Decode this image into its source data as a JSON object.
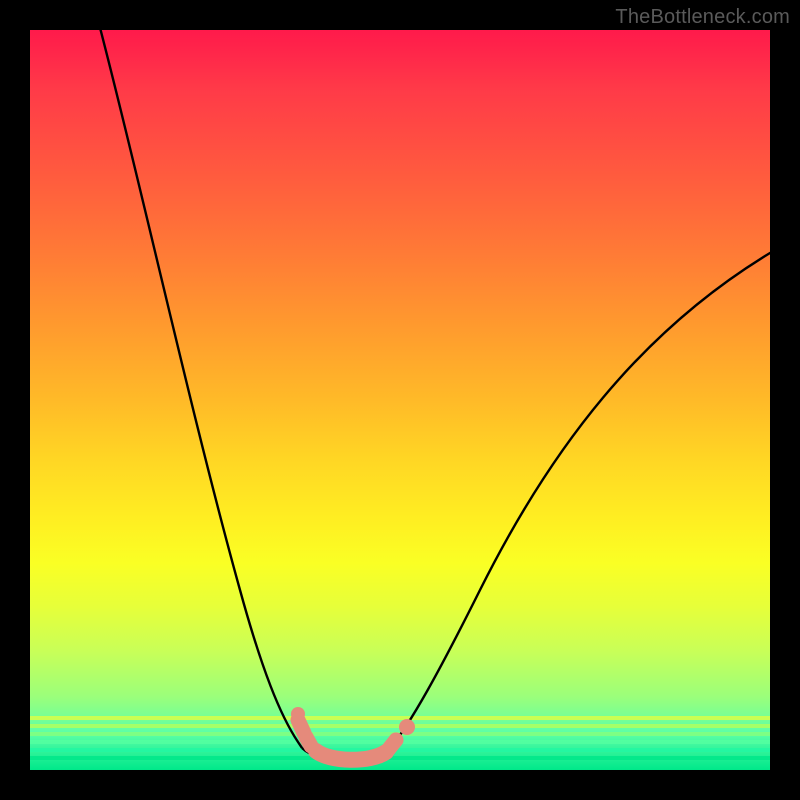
{
  "watermark": "TheBottleneck.com",
  "chart_data": {
    "type": "line",
    "title": "",
    "xlabel": "",
    "ylabel": "",
    "xlim": [
      0,
      100
    ],
    "ylim": [
      0,
      100
    ],
    "background": {
      "type": "vertical-gradient",
      "stops": [
        {
          "pos": 0,
          "color": "#ff1a4b"
        },
        {
          "pos": 50,
          "color": "#ffba28"
        },
        {
          "pos": 72,
          "color": "#faff24"
        },
        {
          "pos": 100,
          "color": "#00e88a"
        }
      ],
      "meaning": "red=high bottleneck, green=low bottleneck"
    },
    "series": [
      {
        "name": "bottleneck-curve",
        "color": "#000000",
        "x": [
          9,
          15,
          22,
          28,
          32,
          36,
          38,
          40,
          44,
          48,
          52,
          58,
          68,
          82,
          100
        ],
        "y": [
          100,
          80,
          55,
          32,
          15,
          5,
          2,
          1,
          2,
          5,
          15,
          30,
          50,
          64,
          72
        ]
      }
    ],
    "highlight_points": {
      "color": "#e58a7b",
      "x": [
        36,
        37,
        38,
        40,
        44,
        48,
        49,
        51
      ],
      "y": [
        7,
        5,
        3,
        1,
        1,
        3,
        4,
        6
      ]
    },
    "grid": false,
    "legend": false
  }
}
